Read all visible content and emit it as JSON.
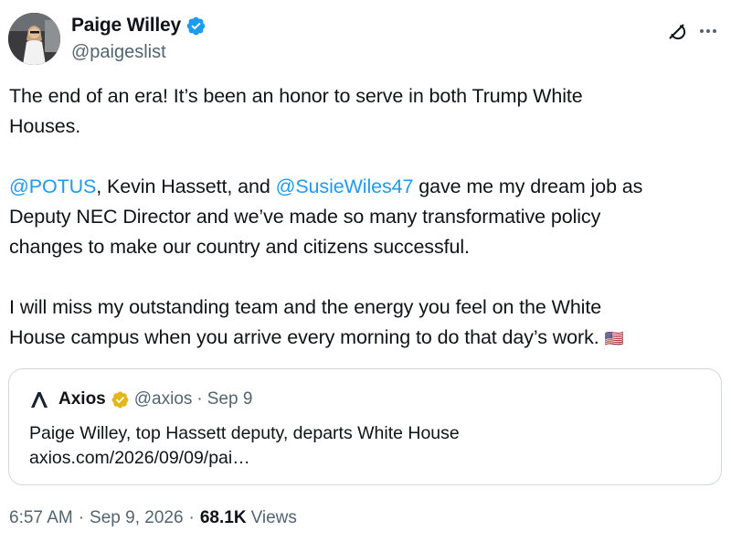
{
  "author": {
    "display_name": "Paige Willey",
    "handle": "@paigeslist",
    "verified_color": "#1d9bf0"
  },
  "tweet": {
    "lines_p1": [
      "The end of an era! It’s been an honor to serve in both Trump White",
      "Houses."
    ],
    "p2": {
      "mention1": "@POTUS",
      "text1": ", Kevin Hassett, and ",
      "mention2": "@SusieWiles47",
      "text2": " gave me my dream job as",
      "line2": "Deputy NEC Director and we’ve made so many transformative policy",
      "line3": "changes to make our country and citizens successful."
    },
    "lines_p3": [
      "I will miss my outstanding team and the energy you feel on the White",
      "House campus when you arrive every morning to do that day’s work."
    ],
    "flag_emoji": "🇺🇸"
  },
  "quote": {
    "name": "Axios",
    "handle": "@axios",
    "separator": "·",
    "date": "Sep 9",
    "badge_color": "#e2b719",
    "text": "Paige Willey, top Hassett deputy, departs White House",
    "link": "axios.com/2026/09/09/pai…"
  },
  "meta": {
    "time": "6:57 AM",
    "separator": "·",
    "date": "Sep 9, 2026",
    "views_count": "68.1K",
    "views_label": "Views"
  },
  "icons": {
    "grok": "grok-icon",
    "more": "more-icon"
  }
}
